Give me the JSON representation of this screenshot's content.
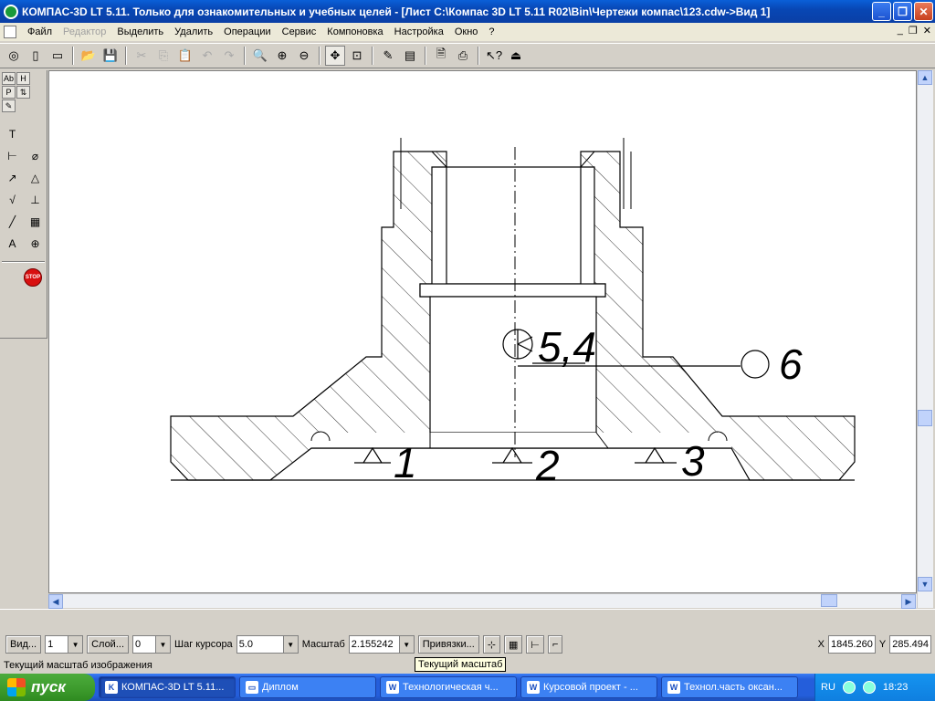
{
  "window": {
    "title": "КОМПАС-3D LT 5.11. Только для ознакомительных и учебных целей - [Лист C:\\Компас 3D LT 5.11 R02\\Bin\\Чертежи компас\\123.cdw->Вид 1]",
    "minimize": "_",
    "maximize": "❐",
    "close": "✕"
  },
  "menu": {
    "items": [
      "Файл",
      "Редактор",
      "Выделить",
      "Удалить",
      "Операции",
      "Сервис",
      "Компоновка",
      "Настройка",
      "Окно",
      "?"
    ],
    "mdi": [
      "_",
      "❐",
      "✕"
    ]
  },
  "toolbar": {
    "icons": [
      "layers-icon",
      "new-doc-icon",
      "new-sheet-icon",
      "open-icon",
      "save-icon",
      "cut-icon",
      "copy-icon",
      "paste-icon",
      "undo-icon",
      "redo-icon",
      "zoom-fit-icon",
      "zoom-in-icon",
      "zoom-out-icon",
      "pan-icon",
      "zoom-window-icon",
      "pencil-icon",
      "frame-icon",
      "preview-icon",
      "print-icon",
      "help-pointer-icon",
      "exit-icon"
    ]
  },
  "left_panel": {
    "tabs": [
      "Ab",
      "H",
      "P",
      "⇅",
      "✎"
    ],
    "stop_label": "STOP"
  },
  "drawing": {
    "callouts": [
      "1",
      "2",
      "3",
      "5,4",
      "6"
    ]
  },
  "params": {
    "view_label": "Вид...",
    "view_value": "1",
    "layer_label": "Слой...",
    "layer_value": "0",
    "step_label": "Шаг курсора",
    "step_value": "5.0",
    "scale_label": "Масштаб",
    "scale_value": "2.155242",
    "snaps_label": "Привязки...",
    "x_label": "X",
    "x_value": "1845.260",
    "y_label": "Y",
    "y_value": "285.494"
  },
  "tooltip": "Текущий масштаб",
  "status": "Текущий масштаб изображения",
  "taskbar": {
    "start": "пуск",
    "tasks": [
      {
        "label": "КОМПАС-3D LT 5.11...",
        "icon": "K",
        "active": true
      },
      {
        "label": "Диплом",
        "icon": "▭",
        "active": false
      },
      {
        "label": "Технологическая ч...",
        "icon": "W",
        "active": false
      },
      {
        "label": "Курсовой проект - ...",
        "icon": "W",
        "active": false
      },
      {
        "label": "Технол.часть оксан...",
        "icon": "W",
        "active": false
      }
    ],
    "lang": "RU",
    "time": "18:23"
  }
}
